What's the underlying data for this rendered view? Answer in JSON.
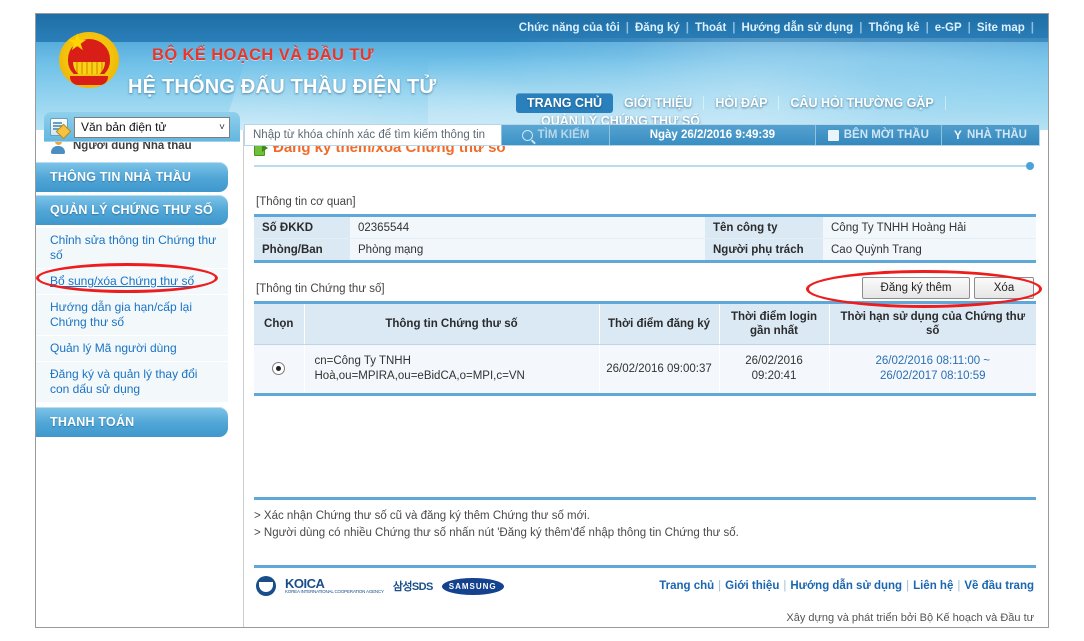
{
  "header": {
    "topnav": [
      "Chức năng của tôi",
      "Đăng ký",
      "Thoát",
      "Hướng dẫn sử dụng",
      "Thống kê",
      "e-GP",
      "Site map"
    ],
    "brand_line1": "BỘ KẾ HOẠCH VÀ ĐẦU TƯ",
    "brand_line2": "HỆ THỐNG ĐẤU THẦU ĐIỆN TỬ",
    "emblem_icon": "vietnam-national-emblem-icon",
    "mainnav": [
      {
        "label": "TRANG CHỦ",
        "active": true
      },
      {
        "label": "GIỚI THIỆU",
        "active": false
      },
      {
        "label": "HỎI ĐÁP",
        "active": false
      },
      {
        "label": "CÂU HỎI THƯỜNG GẶP",
        "active": false
      }
    ],
    "subnav": "QUẢN LÝ CHỨNG THƯ SỐ"
  },
  "doctype": {
    "icon": "document-icon",
    "value": "Văn bản điện tử",
    "arrow": "˅"
  },
  "search": {
    "placeholder": "Nhập từ khóa chính xác để tìm kiếm thông tin",
    "value": "",
    "button_label": "TÌM KIẾM",
    "search_icon": "search-icon",
    "date_label": "Ngày 26/2/2016 9:49:39",
    "right_buttons": [
      {
        "label": "BÊN MỜI THẦU",
        "icon": "book-icon"
      },
      {
        "label": "NHÀ THẦU",
        "icon": "funnel-icon"
      }
    ]
  },
  "sidebar": {
    "user": {
      "icon": "user-icon",
      "label": "Người dùng Nhà thầu"
    },
    "groups": [
      {
        "label": "THÔNG TIN NHÀ THẦU",
        "items": []
      },
      {
        "label": "QUẢN LÝ CHỨNG THƯ SỐ",
        "items": [
          {
            "label": "Chỉnh sửa thông tin Chứng thư số",
            "active": false
          },
          {
            "label": "Bổ sung/xóa Chứng thư số",
            "active": true
          },
          {
            "label": "Hướng dẫn gia hạn/cấp lại Chứng thư số",
            "active": false
          },
          {
            "label": "Quản lý Mã người dùng",
            "active": false
          },
          {
            "label": "Đăng ký và quản lý thay đổi con dấu sử dụng",
            "active": false
          }
        ]
      },
      {
        "label": "THANH TOÁN",
        "items": []
      }
    ]
  },
  "main": {
    "page_title": "Đăng ký thêm/xóa Chứng thư số",
    "page_title_icon": "arrow-forward-icon",
    "org_section_label": "[Thông tin cơ quan]",
    "org_info": [
      {
        "k1": "Số ĐKKD",
        "v1": "02365544",
        "k2": "Tên công ty",
        "v2": "Công Ty TNHH Hoàng Hải"
      },
      {
        "k1": "Phòng/Ban",
        "v1": "Phòng mạng",
        "k2": "Người phụ trách",
        "v2": "Cao Quỳnh Trang"
      }
    ],
    "cert_section_label": "[Thông tin Chứng thư số]",
    "buttons": [
      {
        "label": "Đăng ký thêm",
        "name": "register-more-button"
      },
      {
        "label": "Xóa",
        "name": "delete-button"
      }
    ],
    "cert_columns": [
      "Chọn",
      "Thông tin Chứng thư số",
      "Thời điểm đăng ký",
      "Thời điểm login gần nhất",
      "Thời hạn sử dụng của Chứng thư số"
    ],
    "cert_rows": [
      {
        "selected": true,
        "dn": "cn=Công Ty TNHH Hoà,ou=MPIRA,ou=eBidCA,o=MPI,c=VN",
        "registered_at": "26/02/2016 09:00:37",
        "last_login": "26/02/2016 09:20:41",
        "valid_from": "26/02/2016 08:11:00 ~",
        "valid_to": "26/02/2017 08:10:59"
      }
    ],
    "notes": [
      "> Xác nhận Chứng thư số cũ và đăng ký thêm Chứng thư số mới.",
      "> Người dùng có nhiều Chứng thư số nhấn nút 'Đăng ký thêm'để nhập thông tin Chứng thư số."
    ]
  },
  "footer": {
    "logos": [
      {
        "name": "koica-logo",
        "text": "KOICA",
        "sub": "KOREA INTERNATIONAL COOPERATION AGENCY"
      },
      {
        "name": "samsung-sds-logo",
        "text": "삼성SDS"
      },
      {
        "name": "samsung-logo",
        "text": "SAMSUNG"
      }
    ],
    "links": [
      "Trang chủ",
      "Giới thiệu",
      "Hướng dẫn sử dụng",
      "Liên hệ",
      "Về đầu trang"
    ],
    "credit": "Xây dựng và phát triển bởi Bộ Kế hoạch và Đầu tư"
  },
  "annotations": {
    "colors": {
      "highlight": "#ee1c1c",
      "accent": "#f26a28",
      "brand_blue": "#1a66b0"
    }
  }
}
